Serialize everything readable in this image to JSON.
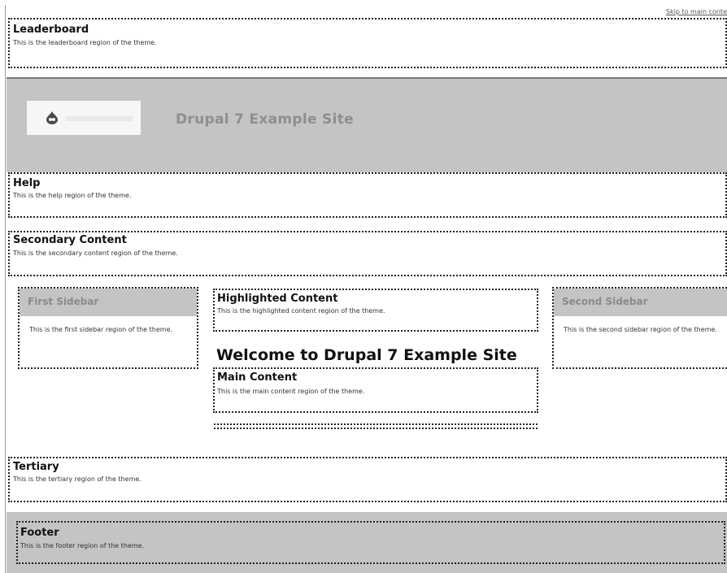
{
  "skip_link": "Skip to main conte",
  "leaderboard": {
    "title": "Leaderboard",
    "desc": "This is the leaderboard region of the theme."
  },
  "header": {
    "site_name": "Drupal 7 Example Site"
  },
  "help": {
    "title": "Help",
    "desc": "This is the help region of the theme."
  },
  "secondary": {
    "title": "Secondary Content",
    "desc": "This is the secondary content region of the theme."
  },
  "first_sidebar": {
    "title": "First Sidebar",
    "desc": "This is the first sidebar region of the theme."
  },
  "highlighted": {
    "title": "Highlighted Content",
    "desc": "This is the highlighted content region of the theme."
  },
  "page_title": "Welcome to Drupal 7 Example Site",
  "main_content": {
    "title": "Main Content",
    "desc": "This is the main content region of the theme."
  },
  "second_sidebar": {
    "title": "Second Sidebar",
    "desc": "This is the second sidebar region of the theme."
  },
  "tertiary": {
    "title": "Tertiary",
    "desc": "This is the tertiary region of the theme."
  },
  "footer": {
    "title": "Footer",
    "desc": "This is the footer region of the theme."
  },
  "colors": {
    "header_band": "#c4c4c4",
    "footer_band": "#c4c4c4",
    "site_name": "#8e8e8e",
    "border": "#222222"
  },
  "icons": {
    "logo": "drupal-drop-icon"
  }
}
